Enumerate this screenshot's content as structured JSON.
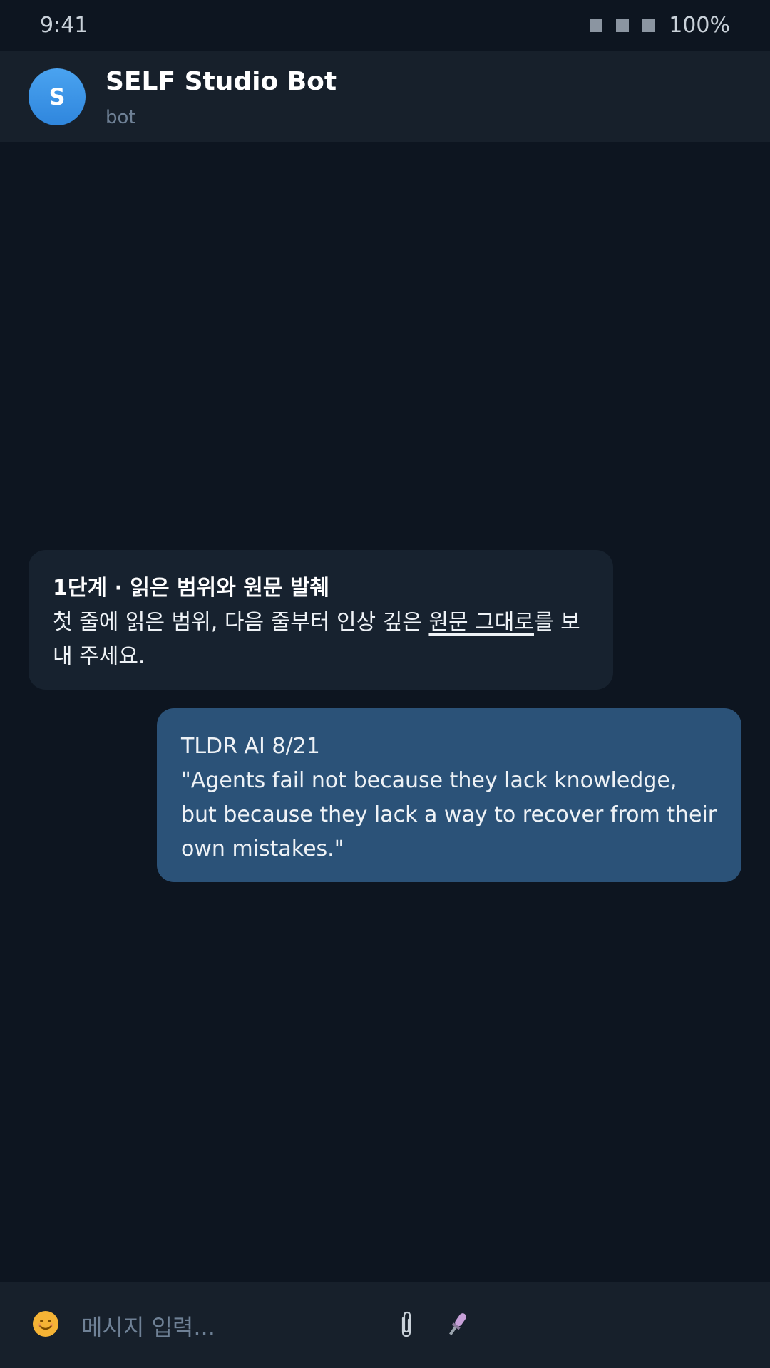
{
  "status_bar": {
    "time": "9:41",
    "battery": "100%"
  },
  "header": {
    "avatar_letter": "S",
    "title": "SELF Studio Bot",
    "subtitle": "bot"
  },
  "messages": {
    "incoming": {
      "title": "1단계 · 읽은 범위와 원문 발췌",
      "text_before": "첫 줄에 읽은 범위, 다음 줄부터 인상 깊은 ",
      "text_underlined": "원문 그대로",
      "text_after": "를 보내 주세요."
    },
    "outgoing": {
      "line1": "TLDR AI 8/21",
      "line2": "\"Agents fail not because they lack knowledge, but because they lack a way to recover from their own mistakes.\""
    }
  },
  "composer": {
    "placeholder": "메시지 입력..."
  },
  "icons": {
    "emoji": "emoji-icon",
    "attach": "paperclip-icon",
    "mic": "microphone-icon"
  },
  "colors": {
    "background": "#0d1520",
    "header": "#17202b",
    "incoming_bubble": "#17222f",
    "outgoing_bubble": "#2b5278",
    "avatar": "#3a95e8"
  }
}
